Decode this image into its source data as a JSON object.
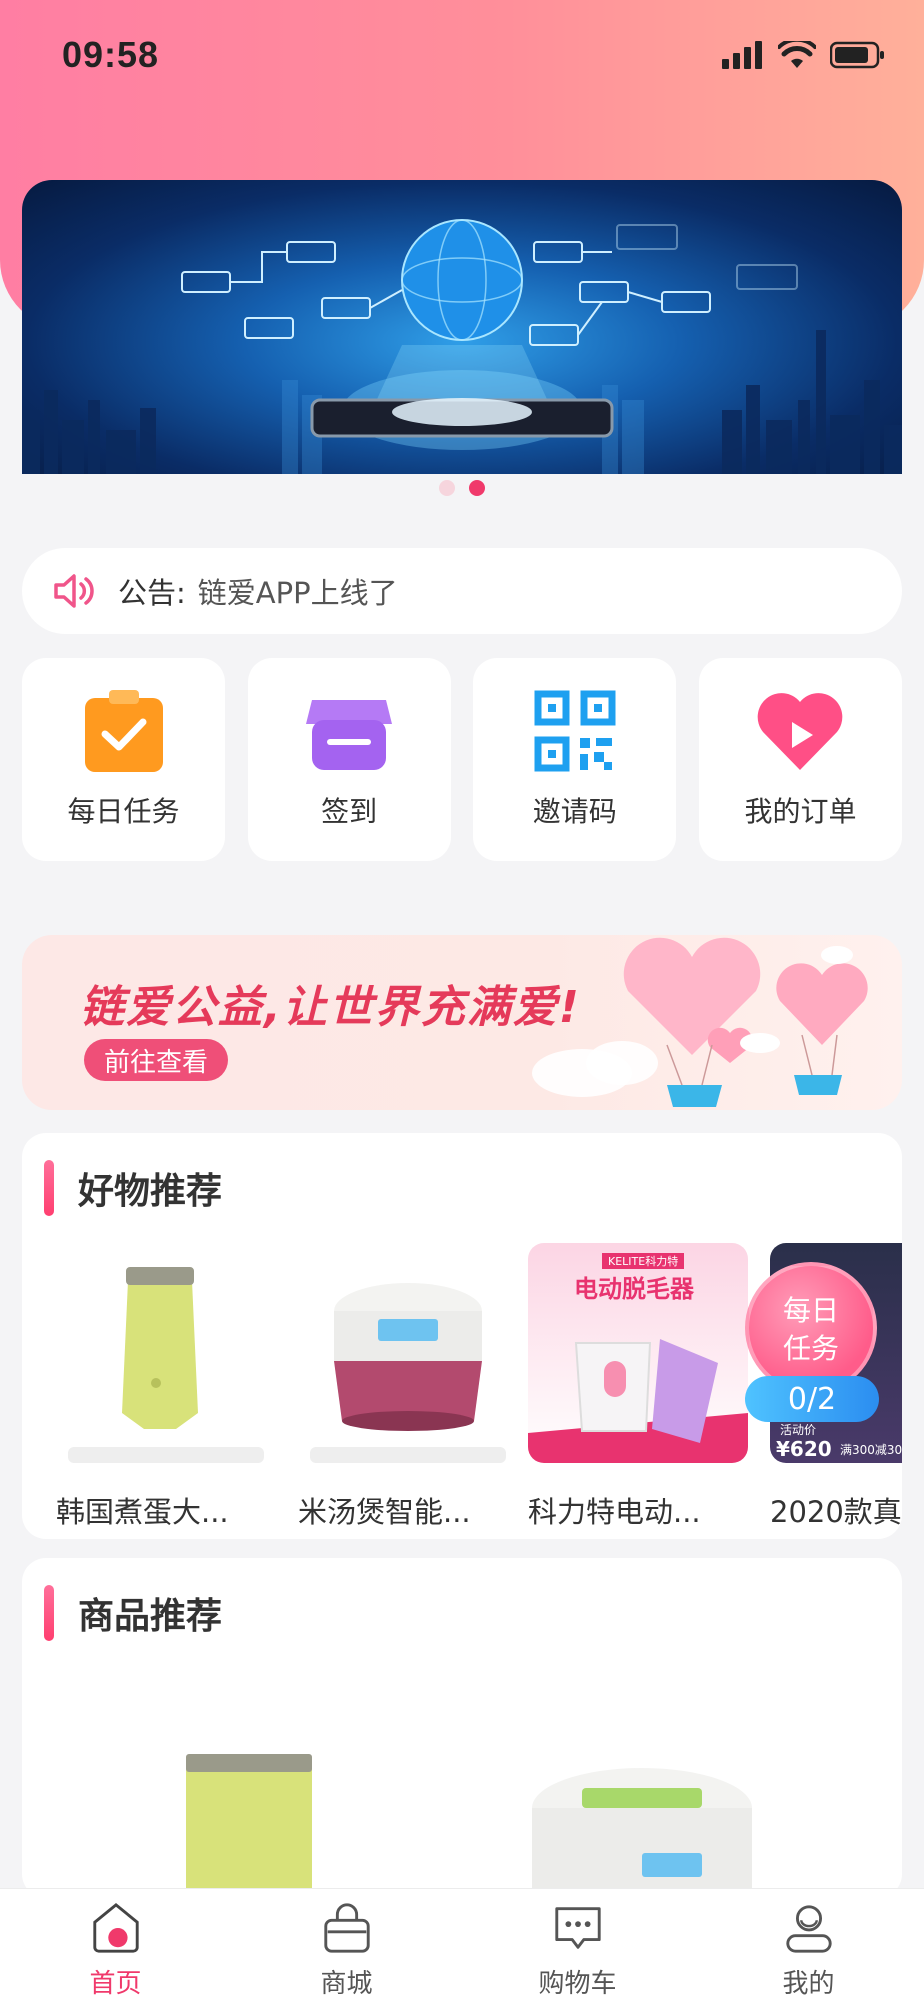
{
  "status_bar": {
    "time": "09:58"
  },
  "banner": {
    "dots": 2,
    "active_index": 1
  },
  "notice": {
    "label": "公告:",
    "text": "链爱APP上线了"
  },
  "quick_actions": [
    {
      "label": "每日任务",
      "icon": "checklist-icon"
    },
    {
      "label": "签到",
      "icon": "shop-icon"
    },
    {
      "label": "邀请码",
      "icon": "qrcode-icon"
    },
    {
      "label": "我的订单",
      "icon": "heart-play-icon"
    }
  ],
  "charity": {
    "title": "链爱公益,让世界充满爱!",
    "button": "前往查看"
  },
  "good_section": {
    "title": "好物推荐",
    "items": [
      {
        "name": "韩国煮蛋大..."
      },
      {
        "name": "米汤煲智能..."
      },
      {
        "name": "科力特电动...",
        "brand": "KELITE科力特",
        "headline": "电动脱毛器"
      },
      {
        "name": "2020款\u0000",
        "price_tag": "活动价",
        "price": "¥620",
        "promo": "满300减30"
      }
    ]
  },
  "task_float": {
    "label_line1": "每日",
    "label_line2": "任务",
    "progress": "0/2"
  },
  "product_section": {
    "title": "商品推荐"
  },
  "tabbar": [
    {
      "label": "首页",
      "active": true
    },
    {
      "label": "商城",
      "active": false
    },
    {
      "label": "购物车",
      "active": false
    },
    {
      "label": "我的",
      "active": false
    }
  ],
  "colors": {
    "accent": "#f0396b",
    "header_start": "#ff7ea3",
    "header_end": "#ffb09a"
  }
}
